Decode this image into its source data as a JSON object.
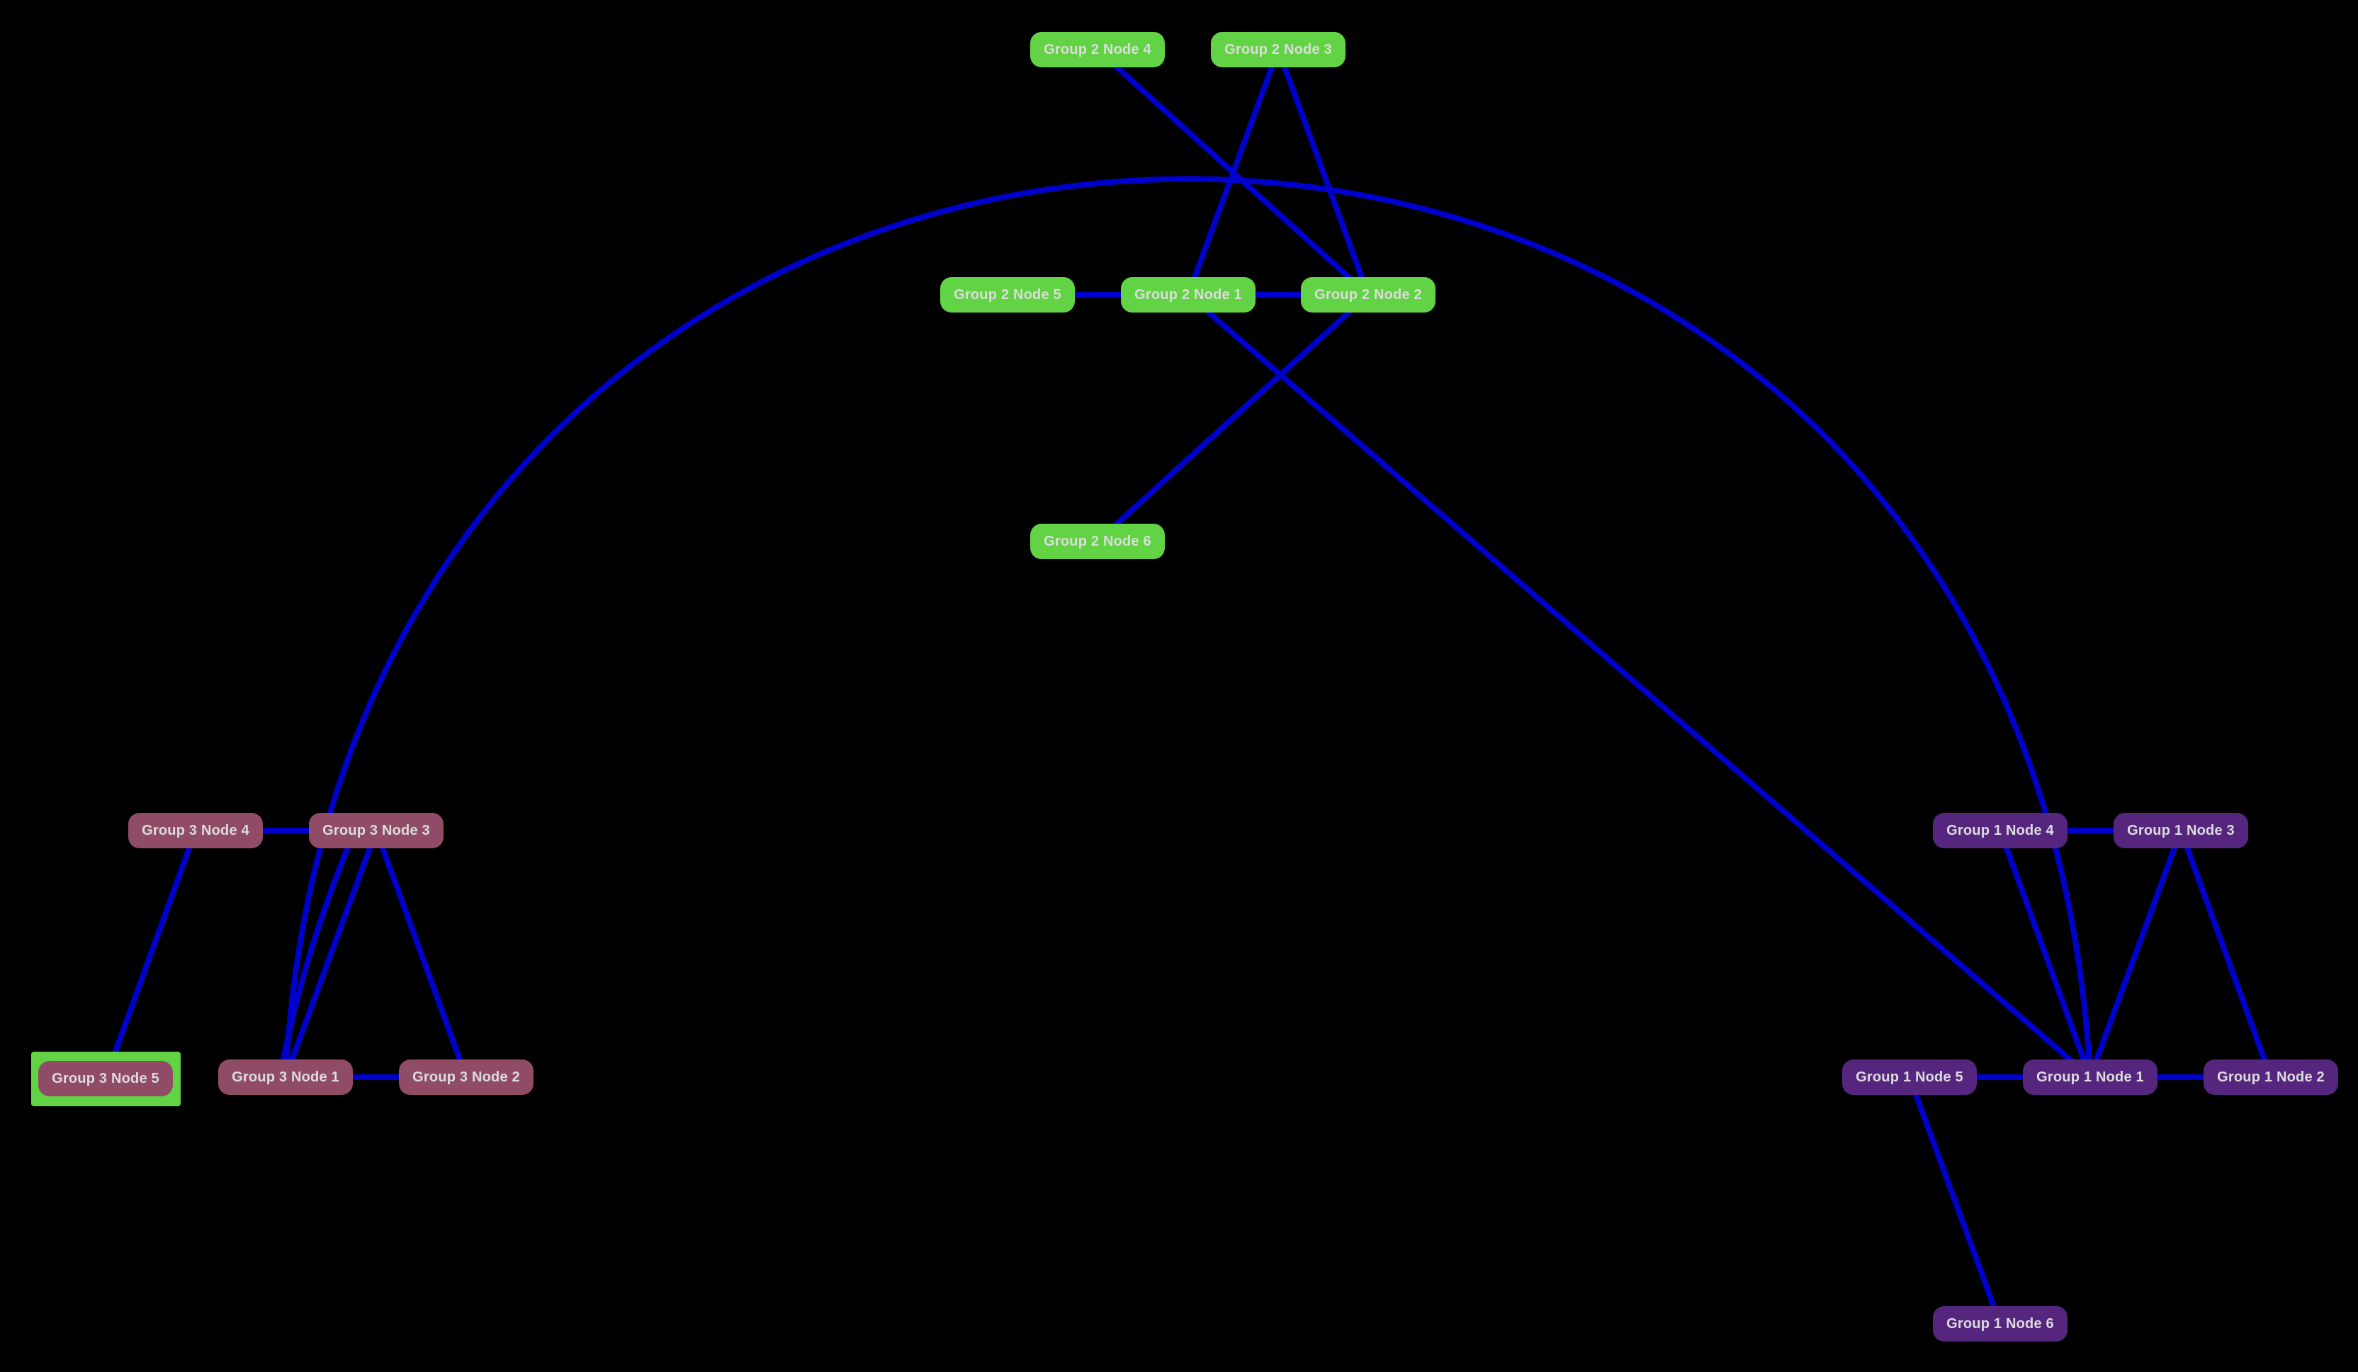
{
  "graph": {
    "background_color": "#000000",
    "edge_color": "#0000CC",
    "label_color": "#DCDCDC",
    "selection_color": "#62D344",
    "selected_node": "g3n5",
    "groups": [
      {
        "id": "group1",
        "name": "Group 1",
        "color": "#56267F"
      },
      {
        "id": "group2",
        "name": "Group 2",
        "color": "#62D344"
      },
      {
        "id": "group3",
        "name": "Group 3",
        "color": "#904C66"
      }
    ],
    "nodes": [
      {
        "id": "g2n4",
        "label": "Group 2 Node 4",
        "group": "group2"
      },
      {
        "id": "g2n3",
        "label": "Group 2 Node 3",
        "group": "group2"
      },
      {
        "id": "g2n5",
        "label": "Group 2 Node 5",
        "group": "group2"
      },
      {
        "id": "g2n1",
        "label": "Group 2 Node 1",
        "group": "group2"
      },
      {
        "id": "g2n2",
        "label": "Group 2 Node 2",
        "group": "group2"
      },
      {
        "id": "g2n6",
        "label": "Group 2 Node 6",
        "group": "group2"
      },
      {
        "id": "g3n4",
        "label": "Group 3 Node 4",
        "group": "group3"
      },
      {
        "id": "g3n3",
        "label": "Group 3 Node 3",
        "group": "group3"
      },
      {
        "id": "g3n5",
        "label": "Group 3 Node 5",
        "group": "group3"
      },
      {
        "id": "g3n1",
        "label": "Group 3 Node 1",
        "group": "group3"
      },
      {
        "id": "g3n2",
        "label": "Group 3 Node 2",
        "group": "group3"
      },
      {
        "id": "g1n4",
        "label": "Group 1 Node 4",
        "group": "group1"
      },
      {
        "id": "g1n3",
        "label": "Group 1 Node 3",
        "group": "group1"
      },
      {
        "id": "g1n5",
        "label": "Group 1 Node 5",
        "group": "group1"
      },
      {
        "id": "g1n1",
        "label": "Group 1 Node 1",
        "group": "group1"
      },
      {
        "id": "g1n2",
        "label": "Group 1 Node 2",
        "group": "group1"
      },
      {
        "id": "g1n6",
        "label": "Group 1 Node 6",
        "group": "group1"
      }
    ],
    "edges": [
      {
        "source": "g2n5",
        "target": "g2n1"
      },
      {
        "source": "g2n1",
        "target": "g2n2"
      },
      {
        "source": "g2n4",
        "target": "g2n2"
      },
      {
        "source": "g2n3",
        "target": "g2n1"
      },
      {
        "source": "g2n3",
        "target": "g2n2"
      },
      {
        "source": "g2n2",
        "target": "g2n6"
      },
      {
        "source": "g2n1",
        "target": "g1n1"
      },
      {
        "source": "g3n4",
        "target": "g3n3"
      },
      {
        "source": "g3n4",
        "target": "g3n5"
      },
      {
        "source": "g3n3",
        "target": "g3n1"
      },
      {
        "source": "g3n3",
        "target": "g3n2"
      },
      {
        "source": "g3n1",
        "target": "g3n2"
      },
      {
        "source": "g1n4",
        "target": "g1n3"
      },
      {
        "source": "g1n4",
        "target": "g1n1"
      },
      {
        "source": "g1n3",
        "target": "g1n1"
      },
      {
        "source": "g1n3",
        "target": "g1n2"
      },
      {
        "source": "g1n5",
        "target": "g1n1"
      },
      {
        "source": "g1n1",
        "target": "g1n2"
      },
      {
        "source": "g1n5",
        "target": "g1n6"
      },
      {
        "source": "g3n1",
        "target": "g1n1",
        "curved": true
      },
      {
        "source": "g3n3",
        "target": "g3n1",
        "curved": true
      }
    ]
  }
}
